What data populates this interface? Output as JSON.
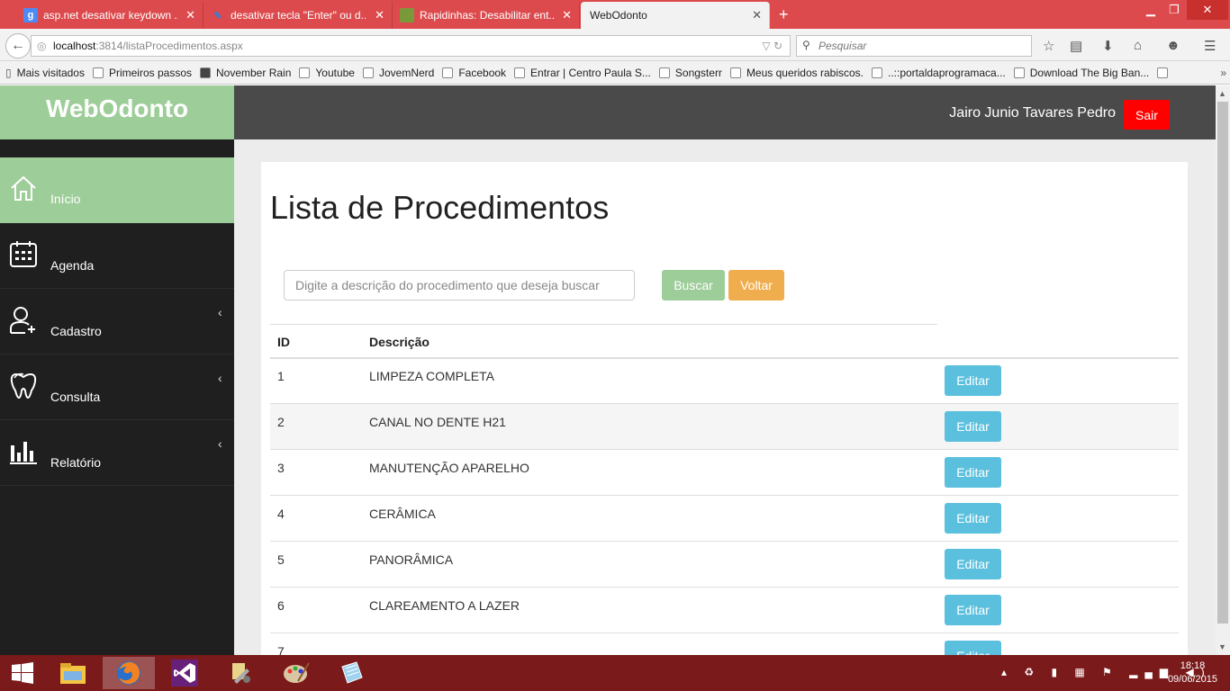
{
  "browser": {
    "tabs": [
      {
        "title": "asp.net desativar keydown ...",
        "fav_letter": "g",
        "fav_color": "#4c8bf5"
      },
      {
        "title": "desativar tecla \"Enter\" ou d...",
        "fav_letter": "",
        "fav_color": "#3a7bd5"
      },
      {
        "title": "Rapidinhas: Desabilitar ent...",
        "fav_letter": "",
        "fav_color": "#7a9a3a"
      },
      {
        "title": "WebOdonto",
        "fav_letter": "",
        "fav_color": "#f2f2f2"
      }
    ],
    "url_host": "localhost",
    "url_rest": ":3814/listaProcedimentos.aspx",
    "search_placeholder": "Pesquisar",
    "bookmarks": [
      "Mais visitados",
      "Primeiros passos",
      "November Rain",
      "Youtube",
      "JovemNerd",
      "Facebook",
      "Entrar | Centro Paula S...",
      "Songsterr",
      "Meus queridos rabiscos.",
      "..::portaldaprogramaca...",
      "Download The Big Ban..."
    ]
  },
  "app": {
    "brand": "WebOdonto",
    "user_name": "Jairo Junio Tavares Pedro",
    "logout_label": "Sair",
    "menu": [
      {
        "label": "Início",
        "icon": "home-icon",
        "active": true,
        "has_chevron": false
      },
      {
        "label": "Agenda",
        "icon": "calendar-icon",
        "active": false,
        "has_chevron": false
      },
      {
        "label": "Cadastro",
        "icon": "user-add-icon",
        "active": false,
        "has_chevron": true
      },
      {
        "label": "Consulta",
        "icon": "tooth-icon",
        "active": false,
        "has_chevron": true
      },
      {
        "label": "Relatório",
        "icon": "bar-chart-icon",
        "active": false,
        "has_chevron": true
      }
    ],
    "page_title": "Lista de Procedimentos",
    "search_placeholder": "Digite a descrição do procedimento que deseja buscar",
    "search_button": "Buscar",
    "back_button": "Voltar",
    "table": {
      "headers": [
        "ID",
        "Descrição"
      ],
      "edit_label": "Editar",
      "rows": [
        {
          "id": "1",
          "desc": "LIMPEZA COMPLETA"
        },
        {
          "id": "2",
          "desc": "CANAL NO DENTE H21"
        },
        {
          "id": "3",
          "desc": "MANUTENÇÃO APARELHO"
        },
        {
          "id": "4",
          "desc": "CERÂMICA"
        },
        {
          "id": "5",
          "desc": "PANORÂMICA"
        },
        {
          "id": "6",
          "desc": "CLAREAMENTO A LAZER"
        },
        {
          "id": "7",
          "desc": ""
        }
      ]
    }
  },
  "taskbar": {
    "time": "18:18",
    "date": "09/06/2015"
  },
  "colors": {
    "brand_green": "#9dcd98",
    "logout_red": "#ff0000",
    "edit_blue": "#5bc0de",
    "back_orange": "#f0ad4e"
  }
}
